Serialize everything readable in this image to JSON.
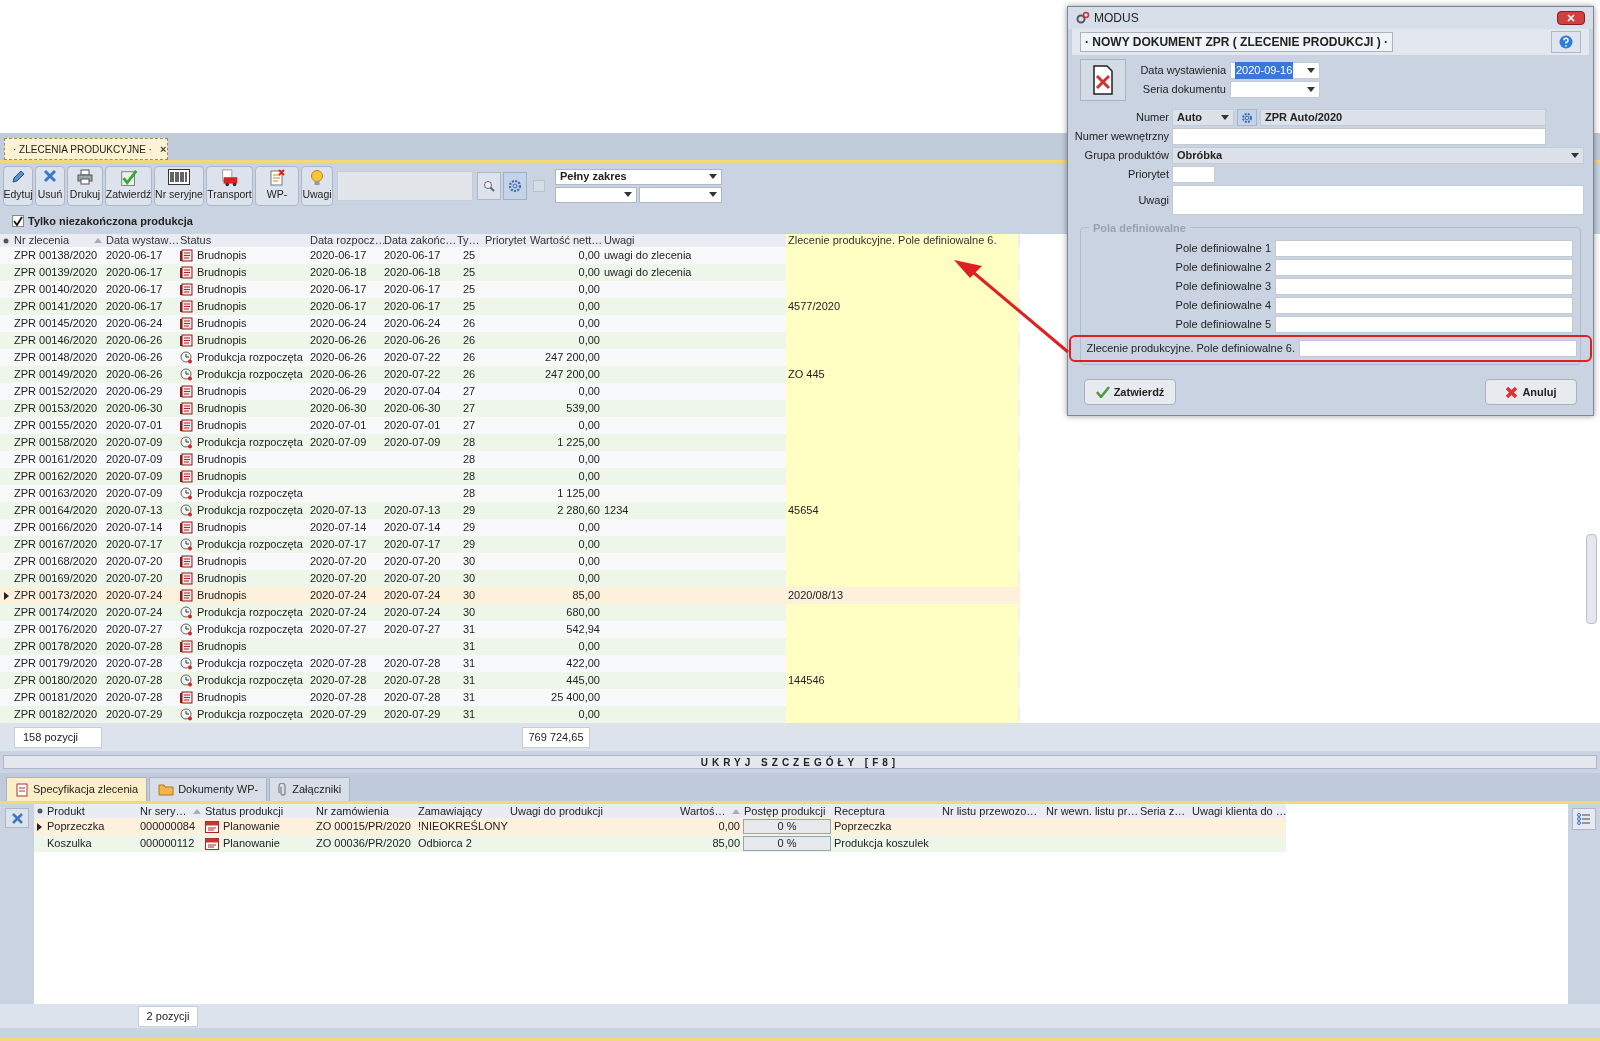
{
  "doc_tab": {
    "label": "· ZLECENIA PRODUKCYJNE ·",
    "close": "×"
  },
  "toolbar": [
    {
      "label": "Edytuj"
    },
    {
      "label": "Usuń"
    },
    {
      "label": "Drukuj"
    },
    {
      "label": "Zatwierdź"
    },
    {
      "label": "Nr seryjne"
    },
    {
      "label": "Transport"
    },
    {
      "label": "WP-"
    },
    {
      "label": "Uwagi"
    }
  ],
  "range_select": {
    "value": "Pełny zakres"
  },
  "option_checkbox": {
    "checked": false
  },
  "filter": {
    "label": "Tylko niezakończona produkcja",
    "checked": true
  },
  "table": {
    "columns": [
      "Nr zlecenia",
      "Data wystaw…",
      "Status",
      "Data rozpocz…",
      "Data zakońc…",
      "Ty…",
      "Priorytet",
      "Wartość nett…",
      "Uwagi",
      "Zlecenie produkcyjne. Pole definiowalne 6."
    ],
    "rows": [
      {
        "nr": "ZPR 00138/2020",
        "issued": "2020-06-17",
        "status": "Brudnopis",
        "kind": "draft",
        "start": "2020-06-17",
        "end": "2020-06-17",
        "ty": "25",
        "value": "0,00",
        "notes": "uwagi do zlecenia",
        "selected": false
      },
      {
        "nr": "ZPR 00139/2020",
        "issued": "2020-06-17",
        "status": "Brudnopis",
        "kind": "draft",
        "start": "2020-06-18",
        "end": "2020-06-18",
        "ty": "25",
        "value": "0,00",
        "notes": "uwagi do zlecenia",
        "selected": false
      },
      {
        "nr": "ZPR 00140/2020",
        "issued": "2020-06-17",
        "status": "Brudnopis",
        "kind": "draft",
        "start": "2020-06-17",
        "end": "2020-06-17",
        "ty": "25",
        "value": "0,00",
        "selected": false
      },
      {
        "nr": "ZPR 00141/2020",
        "issued": "2020-06-17",
        "status": "Brudnopis",
        "kind": "draft",
        "start": "2020-06-17",
        "end": "2020-06-17",
        "ty": "25",
        "value": "0,00",
        "field6": "4577/2020",
        "selected": false
      },
      {
        "nr": "ZPR 00145/2020",
        "issued": "2020-06-24",
        "status": "Brudnopis",
        "kind": "draft",
        "start": "2020-06-24",
        "end": "2020-06-24",
        "ty": "26",
        "value": "0,00",
        "selected": false
      },
      {
        "nr": "ZPR 00146/2020",
        "issued": "2020-06-26",
        "status": "Brudnopis",
        "kind": "draft",
        "start": "2020-06-26",
        "end": "2020-06-26",
        "ty": "26",
        "value": "0,00",
        "selected": false
      },
      {
        "nr": "ZPR 00148/2020",
        "issued": "2020-06-26",
        "status": "Produkcja rozpoczęta",
        "kind": "started",
        "start": "2020-06-26",
        "end": "2020-07-22",
        "ty": "26",
        "value": "247 200,00",
        "selected": false
      },
      {
        "nr": "ZPR 00149/2020",
        "issued": "2020-06-26",
        "status": "Produkcja rozpoczęta",
        "kind": "started",
        "start": "2020-06-26",
        "end": "2020-07-22",
        "ty": "26",
        "value": "247 200,00",
        "field6": "ZO 445",
        "selected": false
      },
      {
        "nr": "ZPR 00152/2020",
        "issued": "2020-06-29",
        "status": "Brudnopis",
        "kind": "draft",
        "start": "2020-06-29",
        "end": "2020-07-04",
        "ty": "27",
        "value": "0,00",
        "selected": false
      },
      {
        "nr": "ZPR 00153/2020",
        "issued": "2020-06-30",
        "status": "Brudnopis",
        "kind": "draft",
        "start": "2020-06-30",
        "end": "2020-06-30",
        "ty": "27",
        "value": "539,00",
        "selected": false
      },
      {
        "nr": "ZPR 00155/2020",
        "issued": "2020-07-01",
        "status": "Brudnopis",
        "kind": "draft",
        "start": "2020-07-01",
        "end": "2020-07-01",
        "ty": "27",
        "value": "0,00",
        "selected": false
      },
      {
        "nr": "ZPR 00158/2020",
        "issued": "2020-07-09",
        "status": "Produkcja rozpoczęta",
        "kind": "started",
        "start": "2020-07-09",
        "end": "2020-07-09",
        "ty": "28",
        "value": "1 225,00",
        "selected": false
      },
      {
        "nr": "ZPR 00161/2020",
        "issued": "2020-07-09",
        "status": "Brudnopis",
        "kind": "draft",
        "ty": "28",
        "value": "0,00",
        "selected": false
      },
      {
        "nr": "ZPR 00162/2020",
        "issued": "2020-07-09",
        "status": "Brudnopis",
        "kind": "draft",
        "ty": "28",
        "value": "0,00",
        "selected": false
      },
      {
        "nr": "ZPR 00163/2020",
        "issued": "2020-07-09",
        "status": "Produkcja rozpoczęta",
        "kind": "started",
        "ty": "28",
        "value": "1 125,00",
        "selected": false
      },
      {
        "nr": "ZPR 00164/2020",
        "issued": "2020-07-13",
        "status": "Produkcja rozpoczęta",
        "kind": "started",
        "start": "2020-07-13",
        "end": "2020-07-13",
        "ty": "29",
        "value": "2 280,60",
        "notes": "1234",
        "field6": "45654",
        "selected": false
      },
      {
        "nr": "ZPR 00166/2020",
        "issued": "2020-07-14",
        "status": "Brudnopis",
        "kind": "draft",
        "start": "2020-07-14",
        "end": "2020-07-14",
        "ty": "29",
        "value": "0,00",
        "selected": false
      },
      {
        "nr": "ZPR 00167/2020",
        "issued": "2020-07-17",
        "status": "Produkcja rozpoczęta",
        "kind": "started",
        "start": "2020-07-17",
        "end": "2020-07-17",
        "ty": "29",
        "value": "0,00",
        "selected": false
      },
      {
        "nr": "ZPR 00168/2020",
        "issued": "2020-07-20",
        "status": "Brudnopis",
        "kind": "draft",
        "start": "2020-07-20",
        "end": "2020-07-20",
        "ty": "30",
        "value": "0,00",
        "selected": false
      },
      {
        "nr": "ZPR 00169/2020",
        "issued": "2020-07-20",
        "status": "Brudnopis",
        "kind": "draft",
        "start": "2020-07-20",
        "end": "2020-07-20",
        "ty": "30",
        "value": "0,00",
        "selected": false
      },
      {
        "nr": "ZPR 00173/2020",
        "issued": "2020-07-24",
        "status": "Brudnopis",
        "kind": "draft",
        "start": "2020-07-24",
        "end": "2020-07-24",
        "ty": "30",
        "value": "85,00",
        "field6": "2020/08/13",
        "selected": true
      },
      {
        "nr": "ZPR 00174/2020",
        "issued": "2020-07-24",
        "status": "Produkcja rozpoczęta",
        "kind": "started",
        "start": "2020-07-24",
        "end": "2020-07-24",
        "ty": "30",
        "value": "680,00",
        "selected": false
      },
      {
        "nr": "ZPR 00176/2020",
        "issued": "2020-07-27",
        "status": "Produkcja rozpoczęta",
        "kind": "started",
        "start": "2020-07-27",
        "end": "2020-07-27",
        "ty": "31",
        "value": "542,94",
        "selected": false
      },
      {
        "nr": "ZPR 00178/2020",
        "issued": "2020-07-28",
        "status": "Brudnopis",
        "kind": "draft",
        "ty": "31",
        "value": "0,00",
        "selected": false
      },
      {
        "nr": "ZPR 00179/2020",
        "issued": "2020-07-28",
        "status": "Produkcja rozpoczęta",
        "kind": "started",
        "start": "2020-07-28",
        "end": "2020-07-28",
        "ty": "31",
        "value": "422,00",
        "selected": false
      },
      {
        "nr": "ZPR 00180/2020",
        "issued": "2020-07-28",
        "status": "Produkcja rozpoczęta",
        "kind": "started",
        "start": "2020-07-28",
        "end": "2020-07-28",
        "ty": "31",
        "value": "445,00",
        "field6": "144546",
        "selected": false
      },
      {
        "nr": "ZPR 00181/2020",
        "issued": "2020-07-28",
        "status": "Brudnopis",
        "kind": "draft",
        "start": "2020-07-28",
        "end": "2020-07-28",
        "ty": "31",
        "value": "25 400,00",
        "selected": false
      },
      {
        "nr": "ZPR 00182/2020",
        "issued": "2020-07-29",
        "status": "Produkcja rozpoczęta",
        "kind": "started",
        "start": "2020-07-29",
        "end": "2020-07-29",
        "ty": "31",
        "value": "0,00",
        "selected": false
      }
    ],
    "count": "158 pozycji",
    "total": "769 724,65"
  },
  "details_toggle": "UKRYJ SZCZEGÓŁY [F8]",
  "detail_tabs": [
    {
      "label": "Specyfikacja zlecenia",
      "selected": true
    },
    {
      "label": "Dokumenty WP-",
      "selected": false
    },
    {
      "label": "Załączniki",
      "selected": false
    }
  ],
  "detail_table": {
    "columns": [
      "Produkt",
      "Nr sery…",
      "Status produkcji",
      "Nr zamówienia",
      "Zamawiający",
      "Uwagi do produkcji",
      "Wartoś…",
      "Postęp produkcji",
      "Receptura",
      "Nr listu przewozo…",
      "Nr wewn. listu pr…",
      "Seria z…",
      "Uwagi klienta do …"
    ],
    "rows": [
      {
        "product": "Poprzeczka",
        "serial": "000000084",
        "status": "Planowanie",
        "order": "ZO 00015/PR/2020",
        "customer": "!NIEOKREŚLONY",
        "value": "0,00",
        "progress": "0 %",
        "level": 0,
        "recipe": "Poprzeczka",
        "selected": true
      },
      {
        "product": "Koszulka",
        "serial": "000000112",
        "status": "Planowanie",
        "order": "ZO 00036/PR/2020",
        "customer": "Odbiorca 2",
        "value": "85,00",
        "progress": "0 %",
        "level": 0,
        "recipe": "Produkcja koszulek",
        "selected": false
      }
    ],
    "count": "2 pozycji"
  },
  "dialog": {
    "title": "MODUS",
    "header": "· NOWY DOKUMENT ZPR ( ZLECENIE PRODUKCJI ) ·",
    "date_label": "Data wystawienia",
    "date_value": "2020-09-16",
    "series_label": "Seria dokumentu",
    "number_label": "Numer",
    "number_mode": "Auto",
    "number_value": "ZPR Auto/2020",
    "internal_label": "Numer wewnętrzny",
    "group_label": "Grupa produktów",
    "group_value": "Obróbka",
    "priority_label": "Priorytet",
    "notes_label": "Uwagi",
    "section": "Pola definiowalne",
    "custom_fields": [
      {
        "label": "Pole definiowalne 1",
        "highlighted": false
      },
      {
        "label": "Pole definiowalne 2",
        "highlighted": false
      },
      {
        "label": "Pole definiowalne 3",
        "highlighted": false
      },
      {
        "label": "Pole definiowalne 4",
        "highlighted": false
      },
      {
        "label": "Pole definiowalne 5",
        "highlighted": false
      },
      {
        "label": "Zlecenie produkcyjne. Pole definiowalne 6.",
        "highlighted": true
      }
    ],
    "confirm": "Zatwierdź",
    "cancel": "Anuluj"
  }
}
